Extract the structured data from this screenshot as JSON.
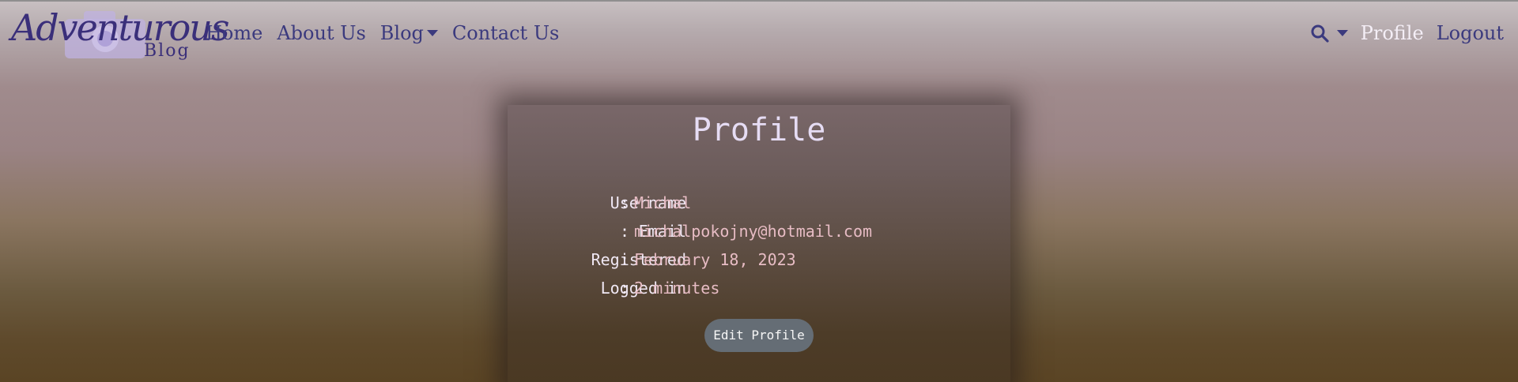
{
  "brand": {
    "logo_script": "Adventurous",
    "logo_sub": "Blog"
  },
  "nav": {
    "left": [
      {
        "label": "Home"
      },
      {
        "label": "About Us"
      },
      {
        "label": "Blog"
      },
      {
        "label": "Contact Us"
      }
    ],
    "right": {
      "search_icon": "search-icon",
      "profile": "Profile",
      "logout": "Logout"
    }
  },
  "profile": {
    "title": "Profile",
    "rows": [
      {
        "label": "Username",
        "separator": ":",
        "value": "Michal"
      },
      {
        "label": "Email",
        "separator": ":",
        "value": "michalpokojny@hotmail.com"
      },
      {
        "label": "Registered",
        "separator": ":",
        "value": "February 18, 2023"
      },
      {
        "label": "Logged in",
        "separator": ":",
        "value": "2 minutes"
      }
    ],
    "edit_button": "Edit Profile"
  },
  "colors": {
    "nav_link": "#3b3a7e",
    "nav_active": "#f4eef6",
    "title": "#e6dcf4",
    "label": "#f0e8f4",
    "value": "#e7bcc4",
    "button_bg": "#656d75"
  }
}
